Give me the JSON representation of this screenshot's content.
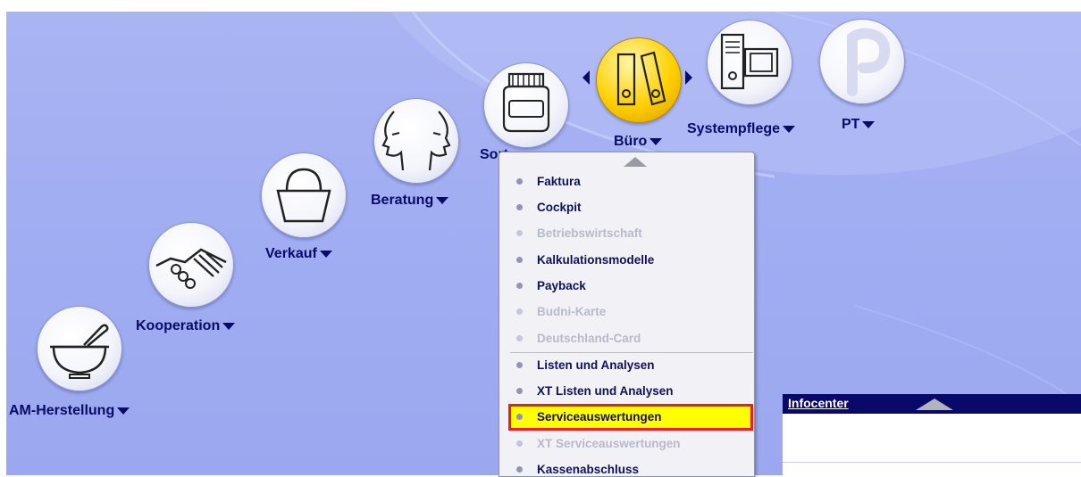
{
  "nav": {
    "am_herstellung": "AM-Herstellung",
    "kooperation": "Kooperation",
    "verkauf": "Verkauf",
    "beratung": "Beratung",
    "sortiment_partial": "Sort",
    "buero": "Büro",
    "systempflege": "Systempflege",
    "pt": "PT"
  },
  "menu": {
    "items": [
      {
        "label": "Faktura",
        "enabled": true
      },
      {
        "label": "Cockpit",
        "enabled": true
      },
      {
        "label": "Betriebswirtschaft",
        "enabled": false
      },
      {
        "label": "Kalkulationsmodelle",
        "enabled": true
      },
      {
        "label": "Payback",
        "enabled": true
      },
      {
        "label": "Budni-Karte",
        "enabled": false
      },
      {
        "label": "Deutschland-Card",
        "enabled": false
      },
      {
        "label": "Listen und Analysen",
        "enabled": true
      },
      {
        "label": "XT Listen und Analysen",
        "enabled": true
      },
      {
        "label": "Serviceauswertungen",
        "enabled": true,
        "highlighted": true
      },
      {
        "label": "XT Serviceauswertungen",
        "enabled": false
      },
      {
        "label": "Kassenabschluss",
        "enabled": true
      }
    ]
  },
  "infocenter": {
    "title": "Infocenter"
  },
  "colors": {
    "background": "#a4b0f2",
    "text": "#0a0a68",
    "highlight": "#ffff00",
    "highlight_border": "#ea1c24",
    "info_header": "#09096a"
  },
  "icons": [
    "mortar-pestle-icon",
    "handshake-icon",
    "shopping-bag-icon",
    "faces-icon",
    "jar-icon",
    "binders-icon",
    "computer-icon",
    "pt-logo-icon"
  ]
}
